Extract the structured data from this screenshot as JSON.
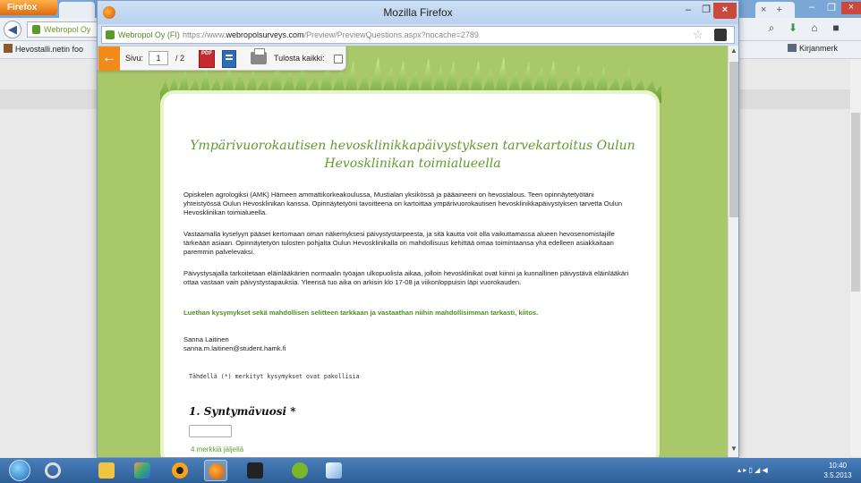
{
  "background_window": {
    "app_button_label": "Firefox",
    "tab_label": "Webropol Oy",
    "tab_right_new": "+",
    "tab_right_close": "×",
    "url_site": "Webropol Oy",
    "window_controls": {
      "minimize": "–",
      "restore": "❐",
      "close": "×"
    },
    "bookmark_left": "Hevostalli.netin foo",
    "bookmark_right": "Kirjanmerk"
  },
  "front_window": {
    "title": "Mozilla Firefox",
    "url_site": "Webropol Oy (FI)",
    "url_prefix": "https://www.",
    "url_domain": "webropolsurveys.com",
    "url_path": "/Preview/PreviewQuestions.aspx?nocache=2789",
    "controls": {
      "minimize": "–",
      "maximize": "❐",
      "close": "×"
    }
  },
  "preview_toolbar": {
    "back_label": "←",
    "page_label": "Sivu:",
    "page_value": "1",
    "page_total": "/ 2",
    "pdf_label": "PDF",
    "print_all_label": "Tulosta kaikki:"
  },
  "survey": {
    "title_line1": "Ympärivuorokautisen hevosklinikkapäivystyksen tarvekartoitus Oulun",
    "title_line2": "Hevosklinikan toimialueella",
    "paragraphs": [
      "Opiskelen agrologiksi (AMK) Hämeen ammattikorkeakoulussa, Mustialan yksikössä ja pääaineeni on hevostalous. Teen opinnäytetyötäni yhteistyössä Oulun Hevosklinikan kanssa. Opinnäytetyöni tavoitteena on kartoittaa ympärivuorokautisen hevosklinikkapäivystyksen tarvetta Oulun Hevosklinikan toimialueella.",
      "Vastaamalla kyselyyn pääset kertomaan oman näkemyksesi päivystystarpeesta, ja sitä kautta voit olla vaikuttamassa alueen hevosenomistajille tärkeään asiaan. Opinnäytetyön tulosten pohjalta Oulun Hevosklinikalla on mahdollisuus kehittää omaa toimintaansa yhä edelleen asiakkaitaan paremmin palvelevaksi.",
      "Päivystysajalla tarkoitetaan eläinlääkärien normaalin työajan ulkopuolista aikaa, jolloin hevosklinikat ovat kiinni ja kunnallinen päivystävä eläinlääkäri ottaa vastaan vain päivystystapauksia. Yleensä tuo aika on arkisin klo 17-08 ja viikonloppuisin läpi vuorokauden."
    ],
    "request": "Luethan kysymykset sekä mahdollisen selitteen tarkkaan ja vastaathan niihin mahdollisimman tarkasti, kiitos.",
    "author_name": "Sanna Laitinen",
    "author_email": "sanna.m.laitinen@student.hamk.fi",
    "required_note": "Tähdellä (*) merkityt kysymykset ovat pakollisia",
    "question1_title": "1. Syntymävuosi *",
    "question1_hint": "4 merkkiä jäljellä"
  },
  "taskbar": {
    "clock_time": "10:40",
    "clock_date": "3.5.2013"
  },
  "colors": {
    "page_green": "#a9c86a",
    "title_green": "#5e9b2c",
    "toolbar_orange": "#f28a1a",
    "taskbar_blue": "#2d5e98"
  }
}
